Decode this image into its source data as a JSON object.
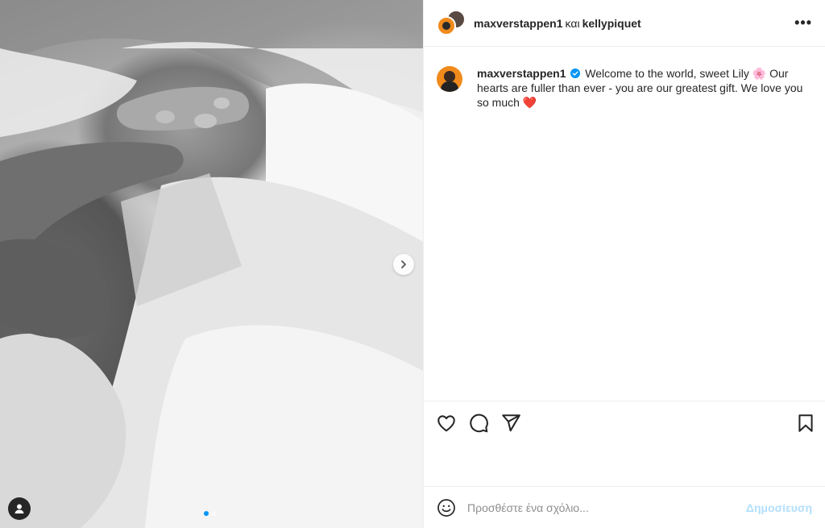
{
  "header": {
    "user_primary": "maxverstappen1",
    "separator": "και",
    "user_secondary": "kellypiquet",
    "more_label": "•••"
  },
  "caption": {
    "username": "maxverstappen1",
    "text_part1": "Welcome to the world, sweet Lily",
    "flower_emoji": "🌸",
    "text_part2": "Our hearts are fuller than ever - you are our greatest gift. We love you so much",
    "heart_emoji": "❤️"
  },
  "media": {
    "carousel_count": 2,
    "current_index": 1
  },
  "comment": {
    "placeholder": "Προσθέστε ένα σχόλιο...",
    "post_label": "Δημοσίευση"
  },
  "colors": {
    "accent": "#0095f6",
    "post_button_disabled": "#b2dffc",
    "verified": "#0095f6",
    "avatar_bg": "#f08a1c"
  }
}
